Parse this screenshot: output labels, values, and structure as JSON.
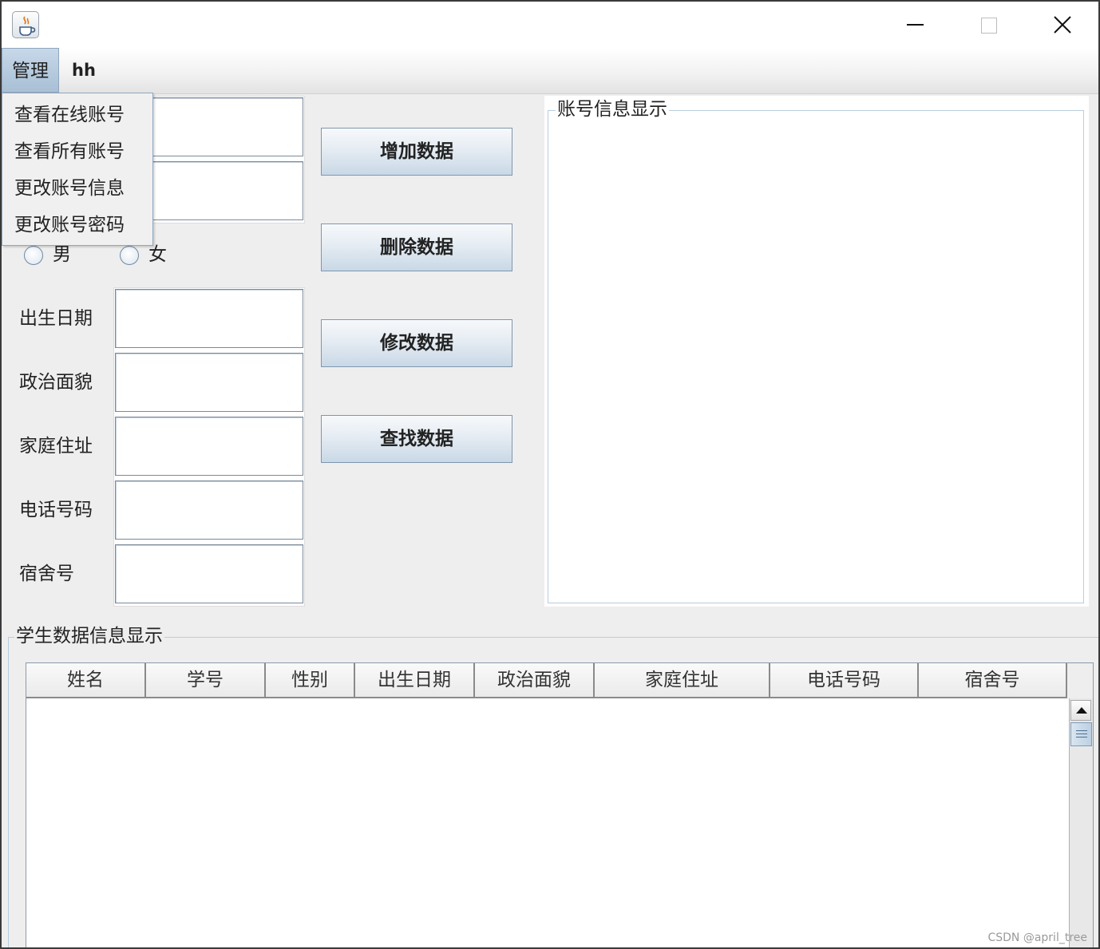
{
  "window": {
    "app_icon": "java-cup-icon",
    "controls": [
      "minimize-icon",
      "maximize-icon",
      "close-icon"
    ]
  },
  "menubar": {
    "manage": "管理",
    "hh": "hh"
  },
  "dropdown": {
    "items": [
      "查看在线账号",
      "查看所有账号",
      "更改账号信息",
      "更改账号密码"
    ]
  },
  "form": {
    "gender_male": "男",
    "gender_female": "女",
    "birth_label": "出生日期",
    "politics_label": "政治面貌",
    "address_label": "家庭住址",
    "phone_label": "电话号码",
    "dorm_label": "宿舍号"
  },
  "buttons": {
    "add": "增加数据",
    "delete": "删除数据",
    "modify": "修改数据",
    "find": "查找数据"
  },
  "account_panel": {
    "title": "账号信息显示"
  },
  "student_panel": {
    "title": "学生数据信息显示",
    "columns": [
      "姓名",
      "学号",
      "性别",
      "出生日期",
      "政治面貌",
      "家庭住址",
      "电话号码",
      "宿舍号"
    ],
    "rows": []
  },
  "watermark": "CSDN @april_tree",
  "colors": {
    "menu_selected": "#b4c8dc",
    "button_gradient_bottom": "#c9d8e6",
    "border_accent": "#b9cddd"
  }
}
